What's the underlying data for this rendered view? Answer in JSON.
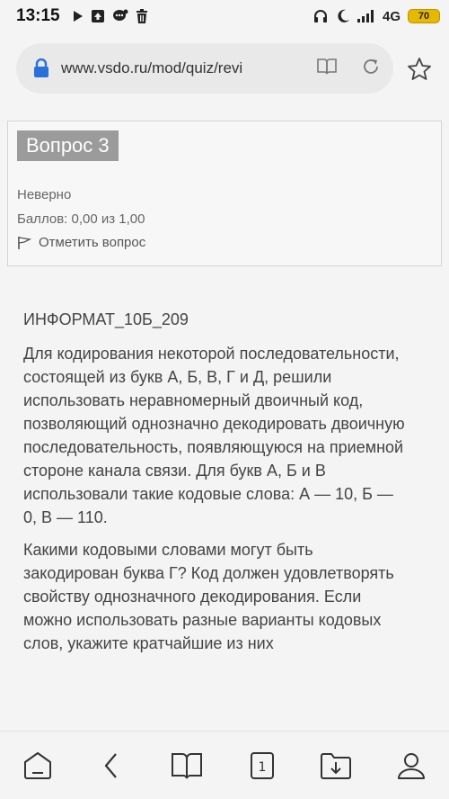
{
  "status_bar": {
    "time": "13:15",
    "network": "4G",
    "battery": "70"
  },
  "browser": {
    "url": "www.vsdo.ru/mod/quiz/revi",
    "tab_count": "1"
  },
  "question": {
    "title": "Вопрос 3",
    "status": "Неверно",
    "score": "Баллов: 0,00 из 1,00",
    "flag_label": "Отметить вопрос",
    "code": "ИНФОРМАТ_10Б_209",
    "paragraphs": [
      "Для кодирования некоторой последовательности, состоящей из букв А, Б, В, Г и Д, решили использовать неравномерный двоичный код, позволяющий однозначно декодировать двоичную последовательность, появляющуюся на приемной стороне канала связи. Для букв А, Б и В использовали такие кодовые слова: А — 10, Б — 0, В — 110.",
      "Какими кодовыми словами могут быть закодирован буква Г? Код должен удовлетворять свойству однозначного декодирования. Если можно использовать разные варианты кодовых слов, укажите кратчайшие из них"
    ]
  },
  "colors": {
    "title_bg": "#9b9b9b",
    "battery": "#e6b800",
    "lock": "#2a6fdb"
  }
}
